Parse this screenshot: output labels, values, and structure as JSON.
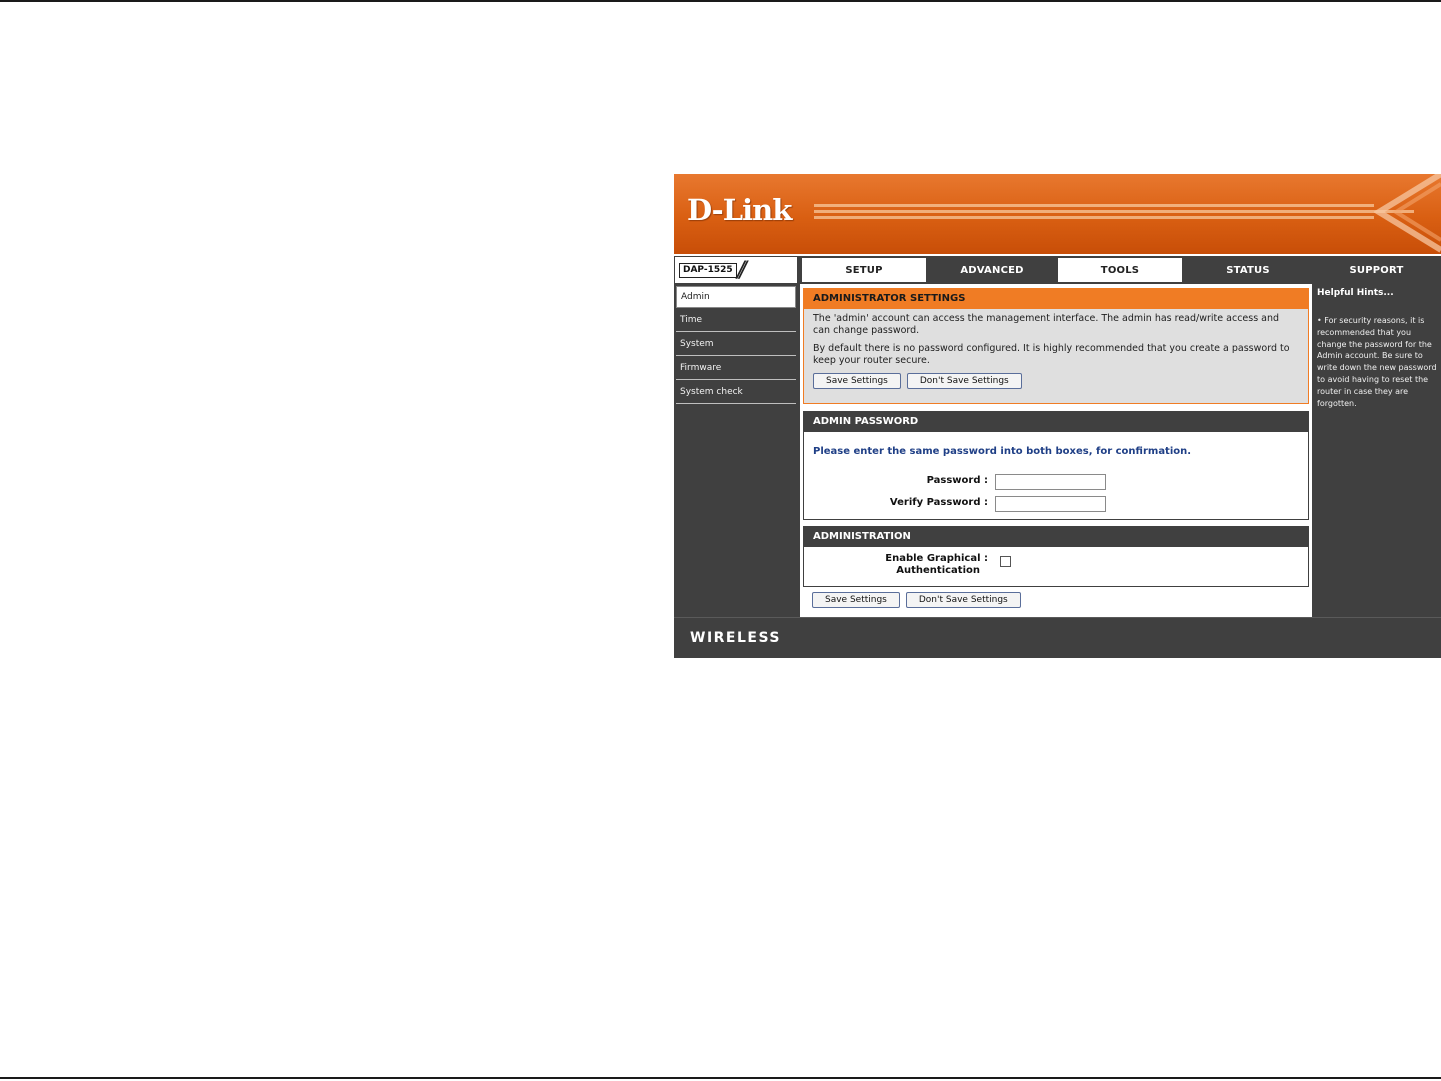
{
  "brand": {
    "logo": "D-Link",
    "model": "DAP-1525",
    "footer": "WIRELESS"
  },
  "nav": {
    "tabs": [
      "SETUP",
      "ADVANCED",
      "TOOLS",
      "STATUS",
      "SUPPORT"
    ],
    "active": "TOOLS"
  },
  "sidebar": {
    "items": [
      {
        "label": "Admin",
        "active": true
      },
      {
        "label": "Time"
      },
      {
        "label": "System"
      },
      {
        "label": "Firmware"
      },
      {
        "label": "System check"
      }
    ]
  },
  "admin_settings": {
    "title": "ADMINISTRATOR SETTINGS",
    "paragraph1": "The 'admin' account can access the management interface. The admin has read/write access and can change password.",
    "paragraph2": "By default there is no password configured. It is highly recommended that you create a password to keep your router secure.",
    "save_label": "Save Settings",
    "dont_save_label": "Don't Save Settings"
  },
  "admin_password": {
    "title": "ADMIN PASSWORD",
    "prompt": "Please enter the same password into both boxes, for confirmation.",
    "password_label": "Password :",
    "verify_label": "Verify Password :",
    "password_value": "",
    "verify_value": ""
  },
  "administration": {
    "title": "ADMINISTRATION",
    "graphical_auth_label_line1": "Enable Graphical :",
    "graphical_auth_label_line2": "Authentication",
    "graphical_auth_checked": false,
    "save_label": "Save Settings",
    "dont_save_label": "Don't Save Settings"
  },
  "hints": {
    "title": "Helpful Hints...",
    "text": "• For security reasons, it is recommended that you change the password for the Admin account. Be sure to write down the new password to avoid having to reset the router in case they are forgotten."
  },
  "colors": {
    "accent": "#f07c24",
    "dark_bg": "#404040",
    "banner": "#d95f12",
    "prompt_blue": "#1f3f86"
  }
}
